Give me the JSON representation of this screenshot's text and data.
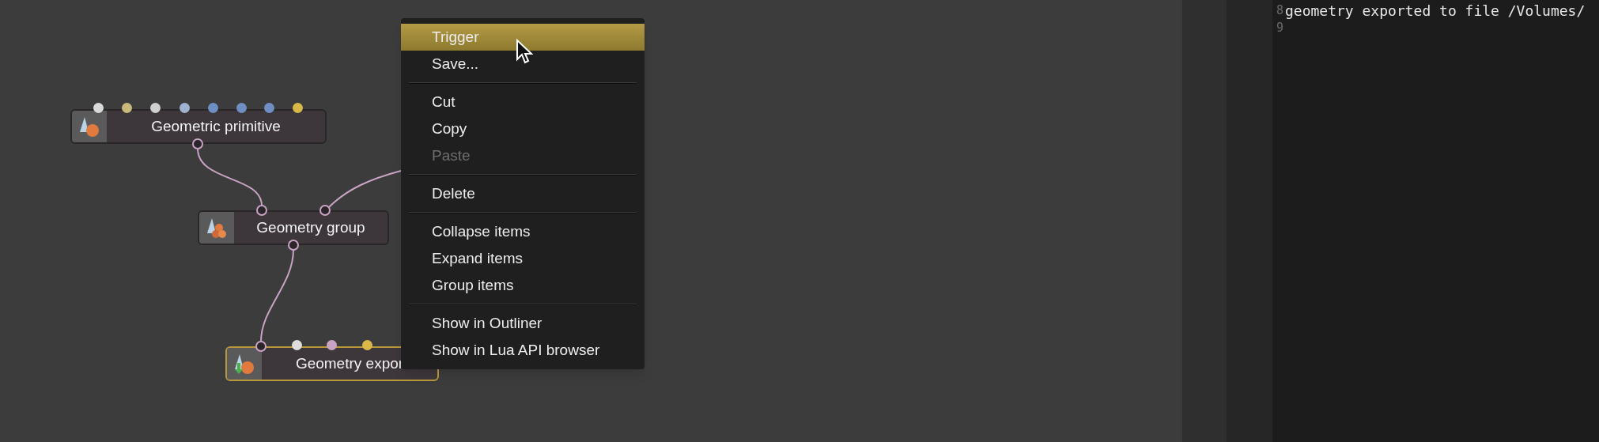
{
  "canvas": {
    "nodes": [
      {
        "kind": "primitive",
        "label": "Geometric primitive",
        "selected": false,
        "ports": [
          {
            "color": "#d9d9d9"
          },
          {
            "color": "#c9b97a"
          },
          {
            "color": "#cfcfcf"
          },
          {
            "color": "#9fb3d0"
          },
          {
            "color": "#6f8fc2"
          },
          {
            "color": "#6f8fc2"
          },
          {
            "color": "#6f8fc2"
          },
          {
            "color": "#d9b84a"
          }
        ]
      },
      {
        "kind": "group",
        "label": "Geometry group",
        "selected": false
      },
      {
        "kind": "export",
        "label": "Geometry expor",
        "selected": true,
        "ports": [
          {
            "color": "#dedede"
          },
          {
            "color": "#c9a3c4"
          },
          {
            "color": "#dcb84a"
          }
        ]
      }
    ]
  },
  "context_menu": {
    "items": [
      {
        "kind": "item",
        "label": "Trigger",
        "selected": true,
        "disabled": false
      },
      {
        "kind": "item",
        "label": "Save...",
        "selected": false,
        "disabled": false
      },
      {
        "kind": "separator"
      },
      {
        "kind": "item",
        "label": "Cut",
        "selected": false,
        "disabled": false
      },
      {
        "kind": "item",
        "label": "Copy",
        "selected": false,
        "disabled": false
      },
      {
        "kind": "item",
        "label": "Paste",
        "selected": false,
        "disabled": true
      },
      {
        "kind": "separator"
      },
      {
        "kind": "item",
        "label": "Delete",
        "selected": false,
        "disabled": false
      },
      {
        "kind": "separator"
      },
      {
        "kind": "item",
        "label": "Collapse items",
        "selected": false,
        "disabled": false
      },
      {
        "kind": "item",
        "label": "Expand items",
        "selected": false,
        "disabled": false
      },
      {
        "kind": "item",
        "label": "Group items",
        "selected": false,
        "disabled": false
      },
      {
        "kind": "separator"
      },
      {
        "kind": "item",
        "label": "Show in Outliner",
        "selected": false,
        "disabled": false
      },
      {
        "kind": "item",
        "label": "Show in Lua API browser",
        "selected": false,
        "disabled": false
      }
    ]
  },
  "console": {
    "lines": [
      {
        "number": "8",
        "text": "geometry exported to file /Volumes/"
      },
      {
        "number": "9"
      }
    ]
  }
}
